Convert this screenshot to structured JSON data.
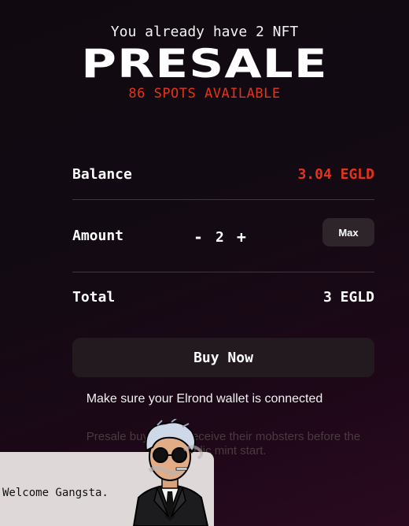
{
  "header": {
    "owned_text": "You already have 2 NFT",
    "title": "PRESALE",
    "spots_text": "86 SPOTS AVAILABLE"
  },
  "balance": {
    "label": "Balance",
    "value": "3.04 EGLD"
  },
  "amount": {
    "label": "Amount",
    "decrement": "-",
    "quantity": "2",
    "increment": "+",
    "max_label": "Max"
  },
  "total": {
    "label": "Total",
    "value": "3 EGLD"
  },
  "buy_button": {
    "label": "Buy Now"
  },
  "notes": {
    "wallet": "Make sure your Elrond wallet is connected",
    "presale": "Presale buyers will receive their mobsters before the public mint start."
  },
  "welcome": {
    "text": "Welcome Gangsta.",
    "avatar_icon": "gangster-avatar-icon"
  },
  "colors": {
    "accent": "#e2341c",
    "button_bg": "#231a1f",
    "max_bg": "#2d2529"
  }
}
